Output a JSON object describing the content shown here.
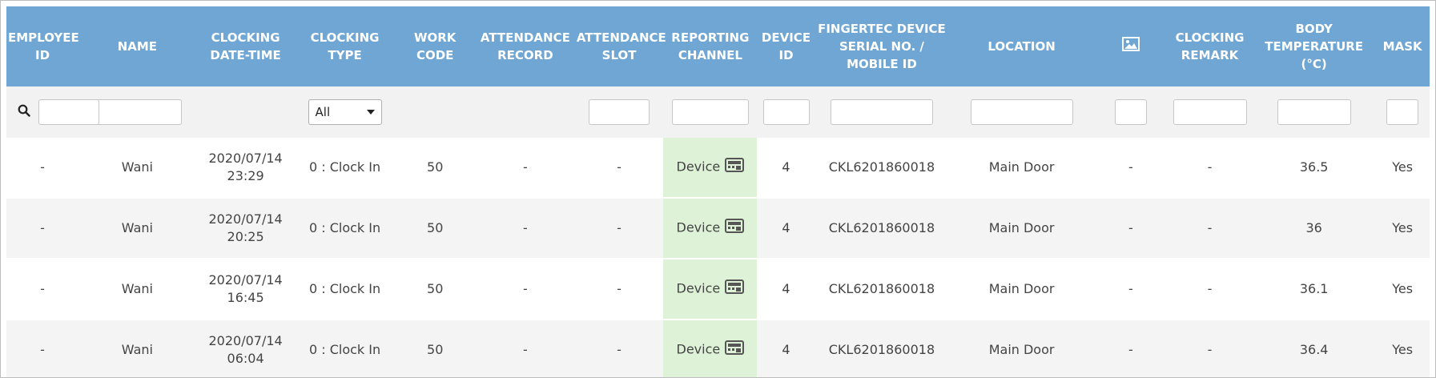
{
  "columns": [
    {
      "label": "EMPLOYEE ID"
    },
    {
      "label": "NAME"
    },
    {
      "label": "CLOCKING DATE-TIME"
    },
    {
      "label": "CLOCKING TYPE"
    },
    {
      "label": "WORK CODE"
    },
    {
      "label": "ATTENDANCE RECORD"
    },
    {
      "label": "ATTENDANCE SLOT"
    },
    {
      "label": "REPORTING CHANNEL"
    },
    {
      "label": "DEVICE ID"
    },
    {
      "label": "FINGERTEC DEVICE SERIAL NO. / MOBILE ID"
    },
    {
      "label": "LOCATION"
    },
    {
      "label": "image-icon"
    },
    {
      "label": "CLOCKING REMARK"
    },
    {
      "label": "BODY TEMPERATURE (°C)"
    },
    {
      "label": "MASK"
    }
  ],
  "filters": {
    "search_icon": "search-icon",
    "clocking_type_selected": "All"
  },
  "rows": [
    {
      "employee_id": "-",
      "name": "Wani",
      "date": "2020/07/14",
      "time": "23:29",
      "clocking_type": "0 : Clock In",
      "work_code": "50",
      "attendance_record": "-",
      "attendance_slot": "-",
      "channel": "Device",
      "device_id": "4",
      "serial": "CKL6201860018",
      "location": "Main Door",
      "image": "-",
      "remark": "-",
      "temperature": "36.5",
      "mask": "Yes"
    },
    {
      "employee_id": "-",
      "name": "Wani",
      "date": "2020/07/14",
      "time": "20:25",
      "clocking_type": "0 : Clock In",
      "work_code": "50",
      "attendance_record": "-",
      "attendance_slot": "-",
      "channel": "Device",
      "device_id": "4",
      "serial": "CKL6201860018",
      "location": "Main Door",
      "image": "-",
      "remark": "-",
      "temperature": "36",
      "mask": "Yes"
    },
    {
      "employee_id": "-",
      "name": "Wani",
      "date": "2020/07/14",
      "time": "16:45",
      "clocking_type": "0 : Clock In",
      "work_code": "50",
      "attendance_record": "-",
      "attendance_slot": "-",
      "channel": "Device",
      "device_id": "4",
      "serial": "CKL6201860018",
      "location": "Main Door",
      "image": "-",
      "remark": "-",
      "temperature": "36.1",
      "mask": "Yes"
    },
    {
      "employee_id": "-",
      "name": "Wani",
      "date": "2020/07/14",
      "time": "06:04",
      "clocking_type": "0 : Clock In",
      "work_code": "50",
      "attendance_record": "-",
      "attendance_slot": "-",
      "channel": "Device",
      "device_id": "4",
      "serial": "CKL6201860018",
      "location": "Main Door",
      "image": "-",
      "remark": "-",
      "temperature": "36.4",
      "mask": "Yes"
    }
  ],
  "colors": {
    "header_bg": "#6fa6d3",
    "filter_bg": "#f2f2f2",
    "channel_bg": "#ddf2d6"
  }
}
